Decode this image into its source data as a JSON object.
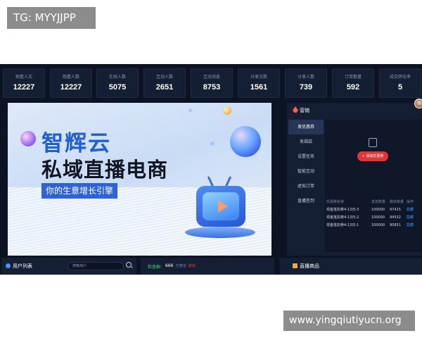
{
  "watermarks": {
    "top_left": "TG: MYYJJPP",
    "bottom_right": "www.yingqiutiyucn.org"
  },
  "stats": [
    {
      "label": "观看人次",
      "value": "12227"
    },
    {
      "label": "观看人数",
      "value": "12227"
    },
    {
      "label": "在线人数",
      "value": "5075"
    },
    {
      "label": "互动人数",
      "value": "2651"
    },
    {
      "label": "互动消息",
      "value": "8753"
    },
    {
      "label": "分享次数",
      "value": "1561"
    },
    {
      "label": "分享人数",
      "value": "739"
    },
    {
      "label": "订单数量",
      "value": "592"
    },
    {
      "label": "成交转化率",
      "value": "5"
    }
  ],
  "banner": {
    "brand": "智辉云",
    "title": "私域直播电商",
    "slogan": "你的生意增长引擎"
  },
  "marketing": {
    "title": "营销",
    "menu": [
      "发优惠券",
      "发福袋",
      "设置任务",
      "智能互动",
      "虚拟订单",
      "直播签到"
    ],
    "add_button": "+ 添加优惠券",
    "table": {
      "headers": [
        "优惠券名称",
        "发放数量",
        "剩余数量",
        "操作"
      ],
      "rows": [
        {
          "name": "现金抵扣券4-13日-3",
          "issued": "100000",
          "remaining": "97415",
          "action": "隐藏"
        },
        {
          "name": "现金抵扣券4-13日-2",
          "issued": "100000",
          "remaining": "94532",
          "action": "隐藏"
        },
        {
          "name": "现金抵扣券4-13日-1",
          "issued": "100000",
          "remaining": "90851",
          "action": "隐藏"
        }
      ]
    }
  },
  "users": {
    "title": "用户列表",
    "search_placeholder": "搜索用户"
  },
  "online": {
    "label": "检查群:",
    "value": "666",
    "blocked_label": "已禁言",
    "blocked_link": "撤销"
  },
  "goods": {
    "title": "直播商品"
  },
  "colors": {
    "background": "#0c1424",
    "panel": "#151f33",
    "accent_red": "#e23535",
    "accent_blue": "#2d62d8"
  }
}
